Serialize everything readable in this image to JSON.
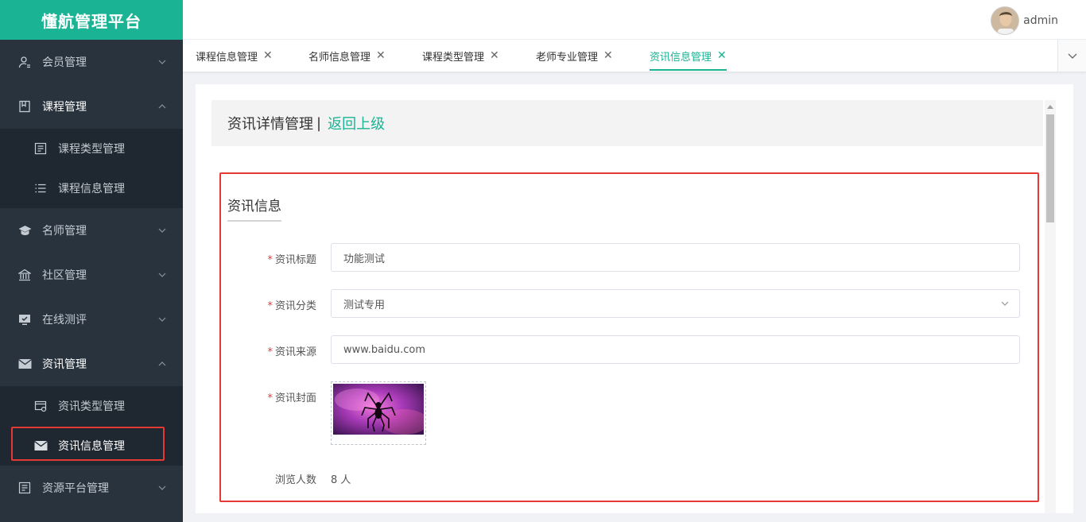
{
  "app": {
    "title": "懂航管理平台"
  },
  "user": {
    "name": "admin"
  },
  "sidebar": {
    "items": [
      {
        "label": "会员管理",
        "icon": "user-icon"
      },
      {
        "label": "课程管理",
        "icon": "book-icon",
        "children": [
          {
            "label": "课程类型管理",
            "icon": "document-icon"
          },
          {
            "label": "课程信息管理",
            "icon": "list-icon"
          }
        ]
      },
      {
        "label": "名师管理",
        "icon": "graduation-cap-icon"
      },
      {
        "label": "社区管理",
        "icon": "bank-icon"
      },
      {
        "label": "在线测评",
        "icon": "monitor-icon"
      },
      {
        "label": "资讯管理",
        "icon": "envelope-icon",
        "children": [
          {
            "label": "资讯类型管理",
            "icon": "card-icon"
          },
          {
            "label": "资讯信息管理",
            "icon": "envelope-icon"
          }
        ]
      },
      {
        "label": "资源平台管理",
        "icon": "document-icon"
      }
    ]
  },
  "tabs": [
    {
      "label": "课程信息管理"
    },
    {
      "label": "名师信息管理"
    },
    {
      "label": "课程类型管理"
    },
    {
      "label": "老师专业管理"
    },
    {
      "label": "资讯信息管理",
      "active": true
    }
  ],
  "page": {
    "title": "资讯详情管理",
    "separator": "|",
    "back_link": "返回上级"
  },
  "form": {
    "section_title": "资讯信息",
    "title_label": "资讯标题",
    "title_value": "功能测试",
    "category_label": "资讯分类",
    "category_value": "测试专用",
    "source_label": "资讯来源",
    "source_value": "www.baidu.com",
    "cover_label": "资讯封面",
    "views_label": "浏览人数",
    "views_value": "8 人",
    "required_mark": "*"
  },
  "colors": {
    "accent": "#1ab394",
    "sidebar_bg": "#28333e",
    "highlight_border": "#e53935"
  }
}
